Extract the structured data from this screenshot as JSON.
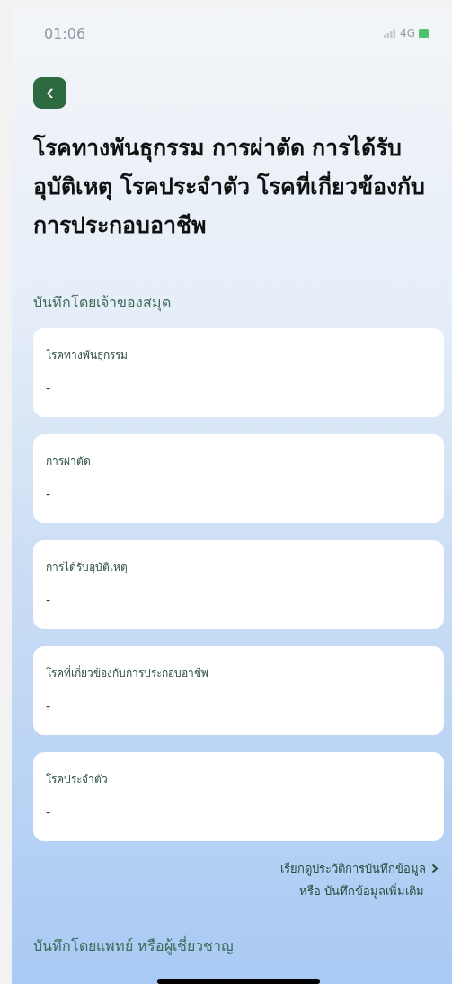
{
  "status_bar": {
    "time": "01:06",
    "network": "4G"
  },
  "back_button": {
    "icon": "‹"
  },
  "title": "โรคทางพันธุกรรม การผ่าตัด การได้รับอุบัติเหตุ โรคประจำตัว โรคที่เกี่ยวข้องกับการประกอบอาชีพ",
  "owner_section": {
    "heading": "บันทึกโดยเจ้าของสมุด",
    "cards": [
      {
        "label": "โรคทางพันธุกรรม",
        "value": "-"
      },
      {
        "label": "การผ่าตัด",
        "value": "-"
      },
      {
        "label": "การได้รับอุบัติเหตุ",
        "value": "-"
      },
      {
        "label": "โรคที่เกี่ยวข้องกับการประกอบอาชีพ",
        "value": "-"
      },
      {
        "label": "โรคประจำตัว",
        "value": "-"
      }
    ],
    "history_link": "เรียกดูประวัติการบันทึกข้อมูล",
    "add_link": "หรือ บันทึกข้อมูลเพิ่มเติม"
  },
  "doctor_section": {
    "heading": "บันทึกโดยแพทย์ หรือผู้เชี่ยวชาญ"
  }
}
